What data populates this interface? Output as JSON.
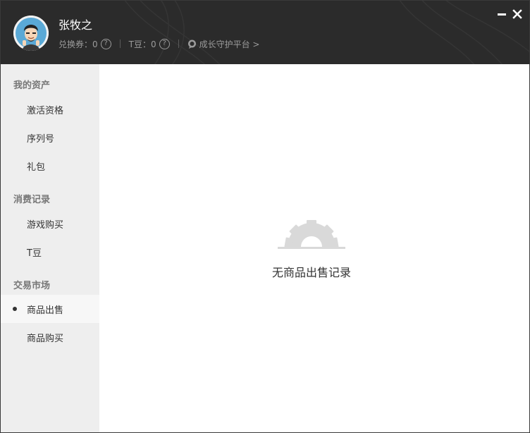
{
  "header": {
    "username": "张牧之",
    "coupon_label": "兑换券：0",
    "tdou_label": "T豆：0",
    "help_glyph": "?",
    "growth_link": "成长守护平台 >",
    "minimize_glyph": "minimize-icon",
    "close_glyph": "close-icon"
  },
  "sidebar": {
    "sections": [
      {
        "title": "我的资产",
        "items": [
          "激活资格",
          "序列号",
          "礼包"
        ]
      },
      {
        "title": "消费记录",
        "items": [
          "游戏购买",
          "T豆"
        ]
      },
      {
        "title": "交易市场",
        "items": [
          "商品出售",
          "商品购买"
        ]
      }
    ],
    "active_item": "商品出售"
  },
  "main": {
    "empty_icon": "gear-icon",
    "empty_message": "无商品出售记录"
  },
  "colors": {
    "header_bg": "#2b2b2b",
    "sidebar_bg": "#eeeeee",
    "active_item_bg": "#f7f7f7",
    "muted_text": "#9b9b9b",
    "empty_icon": "#d9d9d9"
  }
}
